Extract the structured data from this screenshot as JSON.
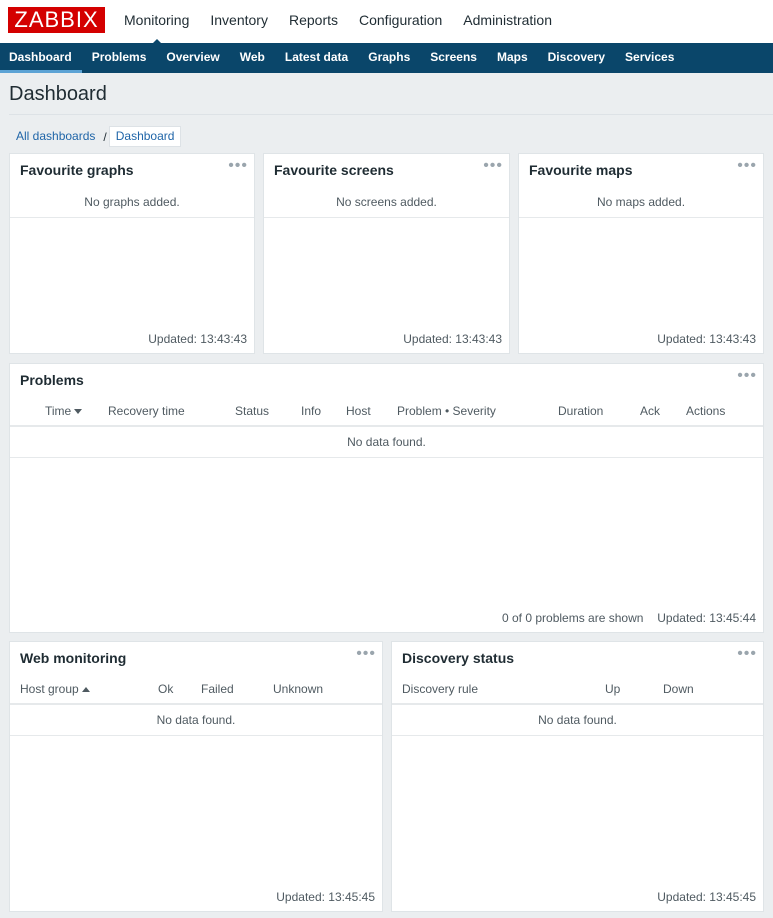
{
  "logo": "ZABBIX",
  "main_nav": [
    "Monitoring",
    "Inventory",
    "Reports",
    "Configuration",
    "Administration"
  ],
  "sub_nav": [
    "Dashboard",
    "Problems",
    "Overview",
    "Web",
    "Latest data",
    "Graphs",
    "Screens",
    "Maps",
    "Discovery",
    "Services"
  ],
  "page_title": "Dashboard",
  "breadcrumb": {
    "all": "All dashboards",
    "separator": "/",
    "current": "Dashboard"
  },
  "menu_glyph": "•••",
  "fav_graphs": {
    "title": "Favourite graphs",
    "empty": "No graphs added.",
    "updated": "Updated: 13:43:43"
  },
  "fav_screens": {
    "title": "Favourite screens",
    "empty": "No screens added.",
    "updated": "Updated: 13:43:43"
  },
  "fav_maps": {
    "title": "Favourite maps",
    "empty": "No maps added.",
    "updated": "Updated: 13:43:43"
  },
  "problems": {
    "title": "Problems",
    "columns": [
      "Time",
      "Recovery time",
      "Status",
      "Info",
      "Host",
      "Problem • Severity",
      "Duration",
      "Ack",
      "Actions"
    ],
    "empty": "No data found.",
    "count": "0 of 0 problems are shown",
    "updated": "Updated: 13:45:44"
  },
  "web_monitoring": {
    "title": "Web monitoring",
    "columns": [
      "Host group",
      "Ok",
      "Failed",
      "Unknown"
    ],
    "empty": "No data found.",
    "updated": "Updated: 13:45:45"
  },
  "discovery_status": {
    "title": "Discovery status",
    "columns": [
      "Discovery rule",
      "Up",
      "Down"
    ],
    "empty": "No data found.",
    "updated": "Updated: 13:45:45"
  }
}
